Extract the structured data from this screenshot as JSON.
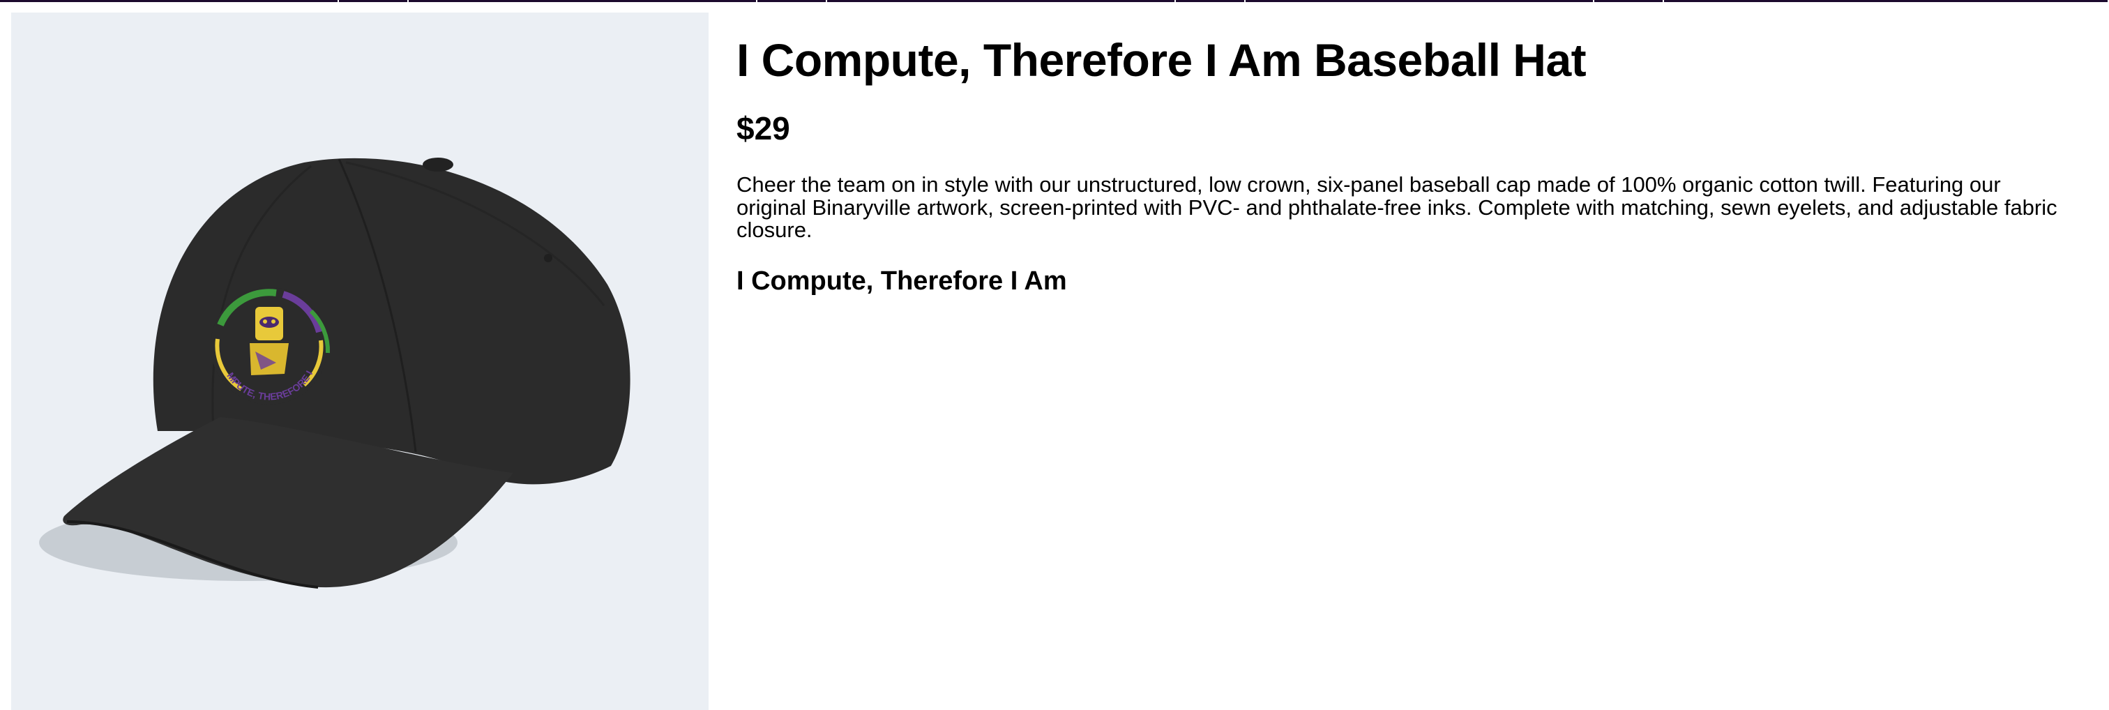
{
  "product": {
    "title": "I Compute, Therefore I Am Baseball Hat",
    "price": "$29",
    "description": "Cheer the team on in style with our unstructured, low crown, six-panel baseball cap made of 100% organic cotton twill. Featuring our original Binaryville artwork, screen-printed with PVC- and phthalate-free inks. Complete with matching, sewn eyelets, and adjustable fabric closure.",
    "subtitle": "I Compute, Therefore I Am",
    "image": {
      "subject": "black baseball cap with robot logo",
      "logo_text": "I COMPUTE, THEREFORE I AM"
    }
  },
  "colors": {
    "nav_bar": "#1c0a2e",
    "image_background": "#ebeff4",
    "cap": "#2b2b2b",
    "logo_yellow": "#e8c93a",
    "logo_purple": "#6a3d9a",
    "logo_green": "#3c9a3c"
  }
}
